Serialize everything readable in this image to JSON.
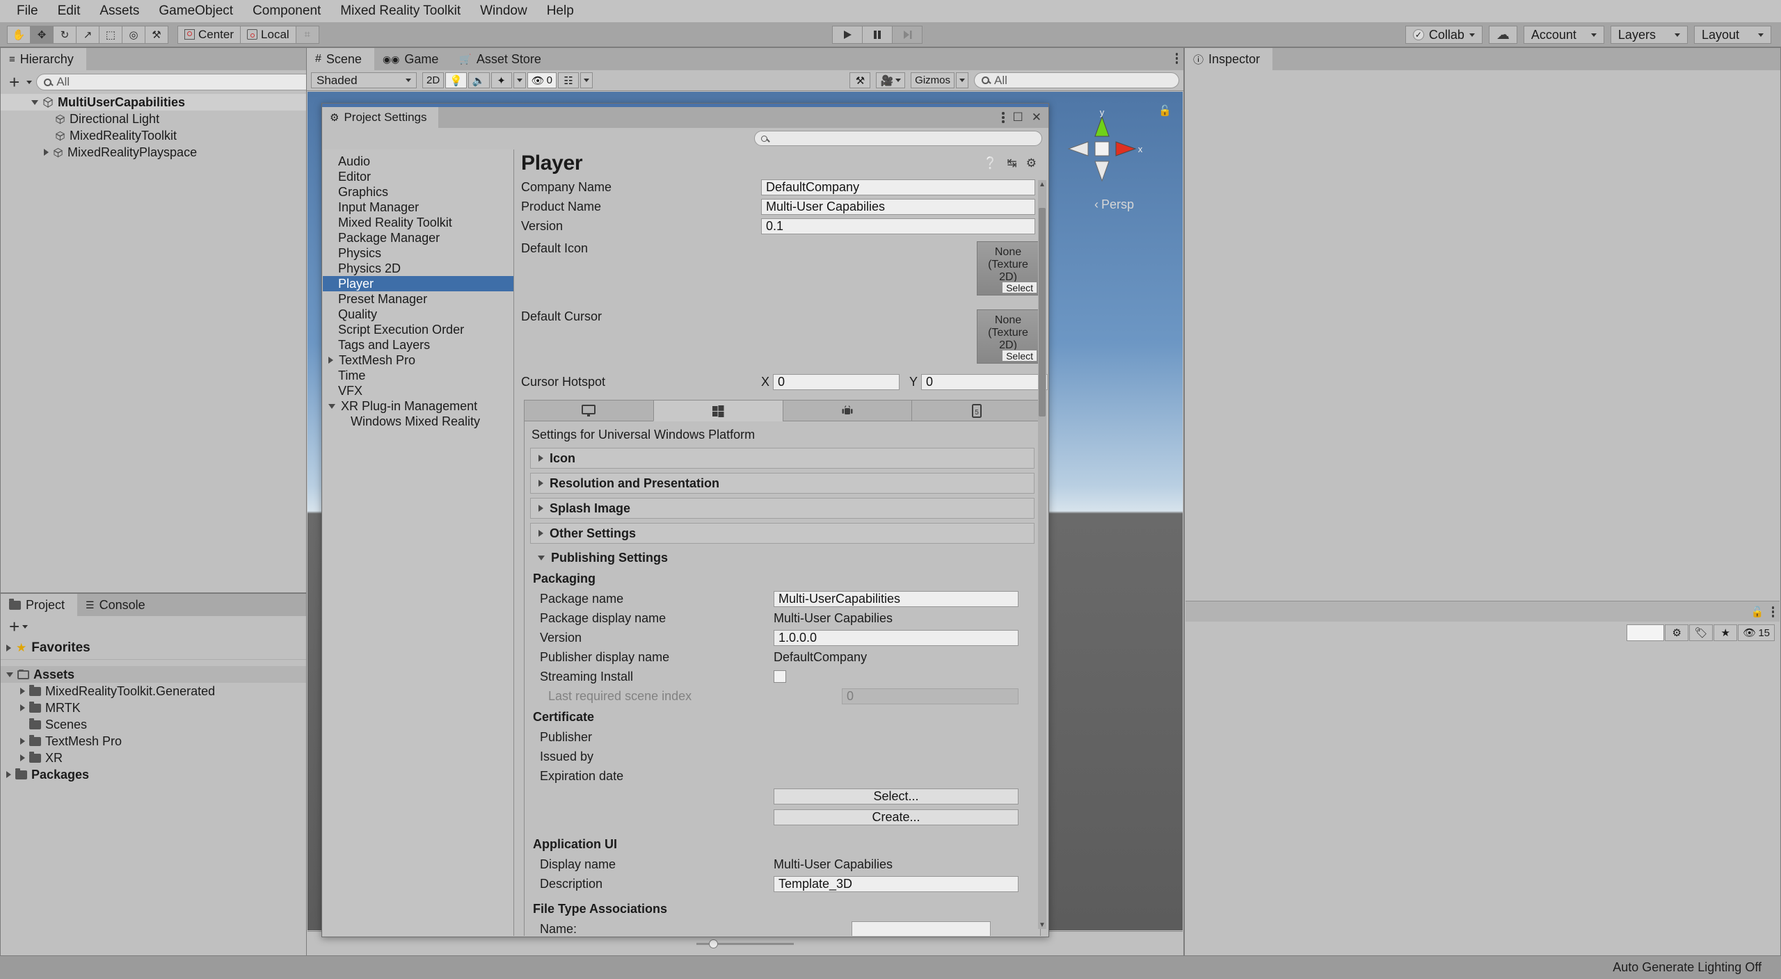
{
  "menubar": {
    "items": [
      "File",
      "Edit",
      "Assets",
      "GameObject",
      "Component",
      "Mixed Reality Toolkit",
      "Window",
      "Help"
    ]
  },
  "toolbar": {
    "tools": [
      {
        "name": "hand-tool",
        "glyph": "✋"
      },
      {
        "name": "move-tool",
        "glyph": "✥"
      },
      {
        "name": "rotate-tool",
        "glyph": "↻"
      },
      {
        "name": "scale-tool",
        "glyph": "↗"
      },
      {
        "name": "rect-tool",
        "glyph": "⬚"
      },
      {
        "name": "transform-tool",
        "glyph": "◎"
      },
      {
        "name": "custom-tool",
        "glyph": "⚒"
      }
    ],
    "pivot_label": "Center",
    "space_label": "Local",
    "grid_label": "⌗",
    "play_label": "▶",
    "pause_label": "❙❙",
    "step_label": "▶❘",
    "collab_label": "Collab",
    "cloud_label": "☁",
    "account_label": "Account",
    "layers_label": "Layers",
    "layout_label": "Layout"
  },
  "hierarchy": {
    "tab_label": "Hierarchy",
    "search_placeholder": "All",
    "add_label": "+",
    "items": [
      {
        "label": "MultiUserCapabilities",
        "depth": 0,
        "expanded": true,
        "selected": true,
        "bold": true
      },
      {
        "label": "Directional Light",
        "depth": 1,
        "expanded": null,
        "selected": false,
        "bold": false
      },
      {
        "label": "MixedRealityToolkit",
        "depth": 1,
        "expanded": null,
        "selected": false,
        "bold": false
      },
      {
        "label": "MixedRealityPlayspace",
        "depth": 1,
        "expanded": false,
        "selected": false,
        "bold": false
      }
    ]
  },
  "project": {
    "tab_label": "Project",
    "console_tab_label": "Console",
    "add_label": "+",
    "favorites_label": "Favorites",
    "items": [
      {
        "label": "Assets",
        "depth": 0,
        "expanded": true,
        "selected": true
      },
      {
        "label": "MixedRealityToolkit.Generated",
        "depth": 1,
        "expanded": false,
        "selected": false
      },
      {
        "label": "MRTK",
        "depth": 1,
        "expanded": false,
        "selected": false
      },
      {
        "label": "Scenes",
        "depth": 1,
        "expanded": null,
        "selected": false
      },
      {
        "label": "TextMesh Pro",
        "depth": 1,
        "expanded": false,
        "selected": false
      },
      {
        "label": "XR",
        "depth": 1,
        "expanded": false,
        "selected": false
      },
      {
        "label": "Packages",
        "depth": 0,
        "expanded": false,
        "selected": false
      }
    ]
  },
  "scene": {
    "tabs": [
      {
        "label": "Scene",
        "icon": "hash-icon",
        "active": true
      },
      {
        "label": "Game",
        "icon": "gamepad-icon",
        "active": false
      },
      {
        "label": "Asset Store",
        "icon": "store-icon",
        "active": false
      }
    ],
    "shading_mode": "Shaded",
    "mode_2d_label": "2D",
    "lighting_icon": "lightbulb-icon",
    "audio_icon": "speaker-icon",
    "fx_icon": "fx-icon",
    "hidden_count": "0",
    "grid_icon": "grid-icon",
    "gizmos_label": "Gizmos",
    "gizmo_search_placeholder": "All",
    "persp_label": "Persp",
    "axis_y": "y",
    "axis_x": "x"
  },
  "inspector": {
    "tab_label": "Inspector",
    "preview_count": "15"
  },
  "project_settings": {
    "window_title": "Project Settings",
    "search_placeholder": "",
    "nav": [
      {
        "label": "Audio",
        "indent": 0,
        "arrow": "none",
        "selected": false
      },
      {
        "label": "Editor",
        "indent": 0,
        "arrow": "none",
        "selected": false
      },
      {
        "label": "Graphics",
        "indent": 0,
        "arrow": "none",
        "selected": false
      },
      {
        "label": "Input Manager",
        "indent": 0,
        "arrow": "none",
        "selected": false
      },
      {
        "label": "Mixed Reality Toolkit",
        "indent": 0,
        "arrow": "none",
        "selected": false
      },
      {
        "label": "Package Manager",
        "indent": 0,
        "arrow": "none",
        "selected": false
      },
      {
        "label": "Physics",
        "indent": 0,
        "arrow": "none",
        "selected": false
      },
      {
        "label": "Physics 2D",
        "indent": 0,
        "arrow": "none",
        "selected": false
      },
      {
        "label": "Player",
        "indent": 0,
        "arrow": "none",
        "selected": true
      },
      {
        "label": "Preset Manager",
        "indent": 0,
        "arrow": "none",
        "selected": false
      },
      {
        "label": "Quality",
        "indent": 0,
        "arrow": "none",
        "selected": false
      },
      {
        "label": "Script Execution Order",
        "indent": 0,
        "arrow": "none",
        "selected": false
      },
      {
        "label": "Tags and Layers",
        "indent": 0,
        "arrow": "none",
        "selected": false
      },
      {
        "label": "TextMesh Pro",
        "indent": 0,
        "arrow": "right",
        "selected": false
      },
      {
        "label": "Time",
        "indent": 0,
        "arrow": "none",
        "selected": false
      },
      {
        "label": "VFX",
        "indent": 0,
        "arrow": "none",
        "selected": false
      },
      {
        "label": "XR Plug-in Management",
        "indent": 0,
        "arrow": "down",
        "selected": false
      },
      {
        "label": "Windows Mixed Reality",
        "indent": 1,
        "arrow": "none",
        "selected": false
      }
    ],
    "player": {
      "title": "Player",
      "help_icon": "help-icon",
      "preset_icon": "preset-icon",
      "gear_icon": "gear-icon",
      "company_name_label": "Company Name",
      "company_name_value": "DefaultCompany",
      "product_name_label": "Product Name",
      "product_name_value": "Multi-User Capabilies",
      "version_label": "Version",
      "version_value": "0.1",
      "default_icon_label": "Default Icon",
      "default_icon_none": "None",
      "default_icon_type": "(Texture 2D)",
      "default_icon_select": "Select",
      "default_cursor_label": "Default Cursor",
      "default_cursor_none": "None",
      "default_cursor_type": "(Texture 2D)",
      "default_cursor_select": "Select",
      "cursor_hotspot_label": "Cursor Hotspot",
      "cursor_hotspot_x_label": "X",
      "cursor_hotspot_x_value": "0",
      "cursor_hotspot_y_label": "Y",
      "cursor_hotspot_y_value": "0",
      "platform_tabs": [
        {
          "name": "standalone",
          "icon": "monitor-icon",
          "active": false
        },
        {
          "name": "uwp",
          "icon": "windows-icon",
          "active": true
        },
        {
          "name": "android",
          "icon": "android-icon",
          "active": false
        },
        {
          "name": "html5",
          "icon": "webgl-icon",
          "active": false
        }
      ],
      "platform_caption": "Settings for Universal Windows Platform",
      "foldouts": [
        {
          "label": "Icon",
          "expanded": false
        },
        {
          "label": "Resolution and Presentation",
          "expanded": false
        },
        {
          "label": "Splash Image",
          "expanded": false
        },
        {
          "label": "Other Settings",
          "expanded": false
        },
        {
          "label": "Publishing Settings",
          "expanded": true
        }
      ],
      "packaging": {
        "title": "Packaging",
        "package_name_label": "Package name",
        "package_name_value": "Multi-UserCapabilities",
        "package_display_name_label": "Package display name",
        "package_display_name_value": "Multi-User Capabilies",
        "version_label": "Version",
        "version_value": "1.0.0.0",
        "publisher_display_name_label": "Publisher display name",
        "publisher_display_name_value": "DefaultCompany",
        "streaming_install_label": "Streaming Install",
        "streaming_install_checked": false,
        "last_scene_index_label": "Last required scene index",
        "last_scene_index_value": "0"
      },
      "certificate": {
        "title": "Certificate",
        "publisher_label": "Publisher",
        "publisher_value": "",
        "issued_by_label": "Issued by",
        "issued_by_value": "",
        "expiration_date_label": "Expiration date",
        "expiration_date_value": "",
        "select_button": "Select...",
        "create_button": "Create..."
      },
      "application_ui": {
        "title": "Application UI",
        "display_name_label": "Display name",
        "display_name_value": "Multi-User Capabilies",
        "description_label": "Description",
        "description_value": "Template_3D"
      },
      "file_type_associations": {
        "title": "File Type Associations",
        "name_label": "Name:",
        "name_value": ""
      }
    }
  },
  "statusbar": {
    "message": "Auto Generate Lighting Off"
  },
  "colors": {
    "accent_blue": "#3e6ea8",
    "panel_bg": "#c0c0c0",
    "chrome_bg": "#a5a5a5",
    "axis_x": "#e03020",
    "axis_y": "#6fd11a"
  }
}
